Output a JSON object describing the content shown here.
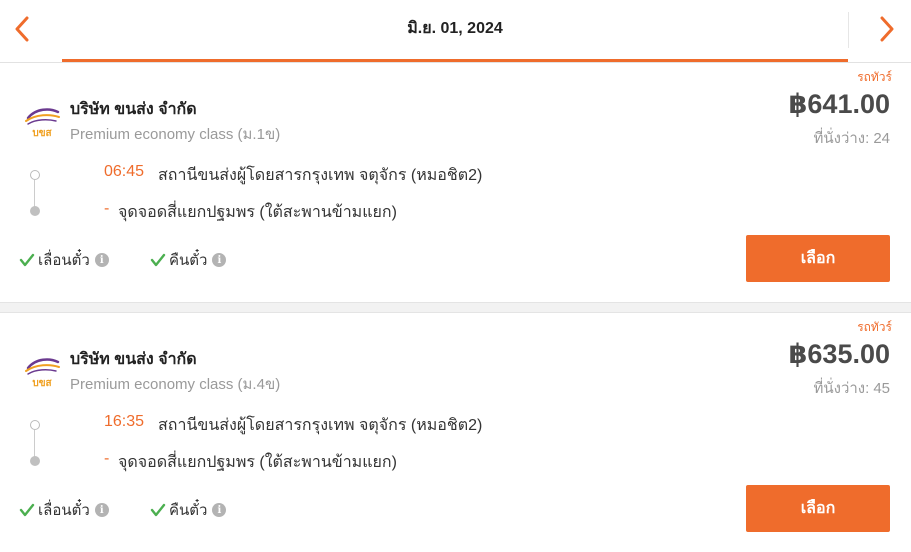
{
  "header": {
    "date": "มิ.ย. 01, 2024",
    "prev_icon": "chevron-left-icon",
    "next_icon": "chevron-right-icon"
  },
  "colors": {
    "accent": "#ef6c2c",
    "text_dark": "#222222",
    "text_muted": "#9a9a9a",
    "check_green": "#4caf50",
    "logo_purple": "#6b3a8f",
    "logo_orange": "#f0a020"
  },
  "trips": [
    {
      "tag": "รถทัวร์",
      "logo_text": "บขส",
      "company": "บริษัท ขนส่ง จำกัด",
      "bus_class": "Premium economy class (ม.1ข)",
      "price": "฿641.00",
      "seats_label": "ที่นั่งว่าง:",
      "seats_count": "24",
      "departure_time": "06:45",
      "departure_station": "สถานีขนส่งผู้โดยสารกรุงเทพ จตุจักร (หมอชิต2)",
      "arrival_marker": "-",
      "arrival_station": "จุดจอดสี่แยกปฐมพร (ใต้สะพานข้ามแยก)",
      "features": [
        "เลื่อนตั๋ว",
        "คืนตั๋ว"
      ],
      "select_label": "เลือก"
    },
    {
      "tag": "รถทัวร์",
      "logo_text": "บขส",
      "company": "บริษัท ขนส่ง จำกัด",
      "bus_class": "Premium economy class (ม.4ข)",
      "price": "฿635.00",
      "seats_label": "ที่นั่งว่าง:",
      "seats_count": "45",
      "departure_time": "16:35",
      "departure_station": "สถานีขนส่งผู้โดยสารกรุงเทพ จตุจักร (หมอชิต2)",
      "arrival_marker": "-",
      "arrival_station": "จุดจอดสี่แยกปฐมพร (ใต้สะพานข้ามแยก)",
      "features": [
        "เลื่อนตั๋ว",
        "คืนตั๋ว"
      ],
      "select_label": "เลือก"
    }
  ]
}
